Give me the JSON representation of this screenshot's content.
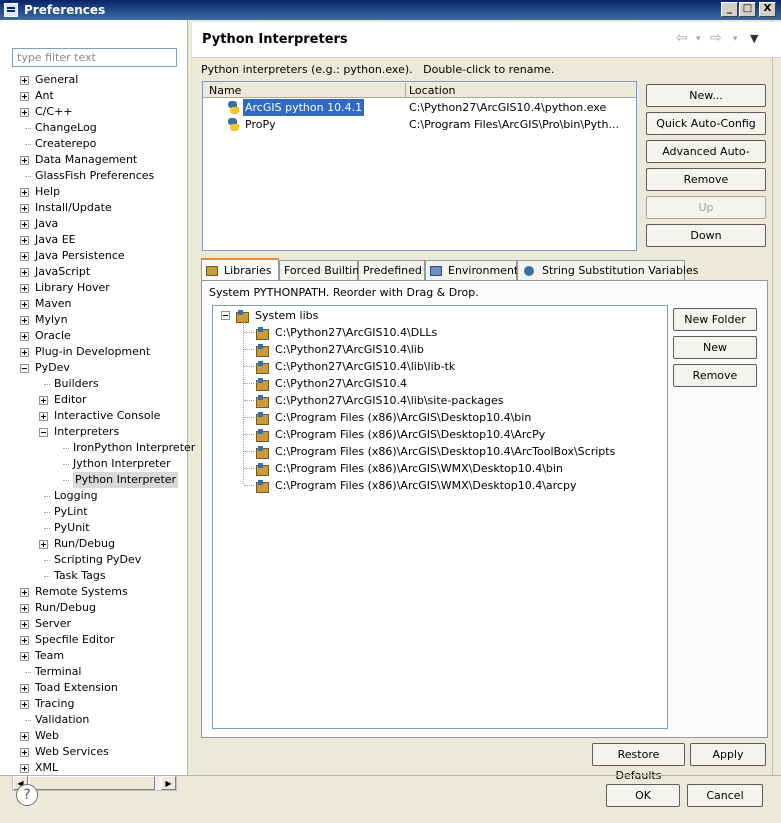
{
  "window": {
    "title": "Preferences",
    "min_label": "_",
    "max_label": "□",
    "close_label": "X"
  },
  "filter": {
    "placeholder": "type filter text"
  },
  "tree": [
    {
      "label": "General",
      "exp": "plus"
    },
    {
      "label": "Ant",
      "exp": "plus"
    },
    {
      "label": "C/C++",
      "exp": "plus"
    },
    {
      "label": "ChangeLog",
      "exp": ""
    },
    {
      "label": "Createrepo",
      "exp": ""
    },
    {
      "label": "Data Management",
      "exp": "plus"
    },
    {
      "label": "GlassFish Preferences",
      "exp": ""
    },
    {
      "label": "Help",
      "exp": "plus"
    },
    {
      "label": "Install/Update",
      "exp": "plus"
    },
    {
      "label": "Java",
      "exp": "plus"
    },
    {
      "label": "Java EE",
      "exp": "plus"
    },
    {
      "label": "Java Persistence",
      "exp": "plus"
    },
    {
      "label": "JavaScript",
      "exp": "plus"
    },
    {
      "label": "Library Hover",
      "exp": "plus"
    },
    {
      "label": "Maven",
      "exp": "plus"
    },
    {
      "label": "Mylyn",
      "exp": "plus"
    },
    {
      "label": "Oracle",
      "exp": "plus"
    },
    {
      "label": "Plug-in Development",
      "exp": "plus"
    },
    {
      "label": "PyDev",
      "exp": "minus"
    },
    {
      "label": "Builders",
      "exp": "",
      "lvl": 1
    },
    {
      "label": "Editor",
      "exp": "plus",
      "lvl": 1
    },
    {
      "label": "Interactive Console",
      "exp": "plus",
      "lvl": 1
    },
    {
      "label": "Interpreters",
      "exp": "minus",
      "lvl": 1
    },
    {
      "label": "IronPython Interpreter",
      "exp": "",
      "lvl": 2
    },
    {
      "label": "Jython Interpreter",
      "exp": "",
      "lvl": 2
    },
    {
      "label": "Python Interpreter",
      "exp": "",
      "lvl": 2,
      "selected": true
    },
    {
      "label": "Logging",
      "exp": "",
      "lvl": 1
    },
    {
      "label": "PyLint",
      "exp": "",
      "lvl": 1
    },
    {
      "label": "PyUnit",
      "exp": "",
      "lvl": 1
    },
    {
      "label": "Run/Debug",
      "exp": "plus",
      "lvl": 1
    },
    {
      "label": "Scripting PyDev",
      "exp": "",
      "lvl": 1
    },
    {
      "label": "Task Tags",
      "exp": "",
      "lvl": 1
    },
    {
      "label": "Remote Systems",
      "exp": "plus"
    },
    {
      "label": "Run/Debug",
      "exp": "plus"
    },
    {
      "label": "Server",
      "exp": "plus"
    },
    {
      "label": "Specfile Editor",
      "exp": "plus"
    },
    {
      "label": "Team",
      "exp": "plus"
    },
    {
      "label": "Terminal",
      "exp": ""
    },
    {
      "label": "Toad Extension",
      "exp": "plus"
    },
    {
      "label": "Tracing",
      "exp": "plus"
    },
    {
      "label": "Validation",
      "exp": ""
    },
    {
      "label": "Web",
      "exp": "plus"
    },
    {
      "label": "Web Services",
      "exp": "plus"
    },
    {
      "label": "XML",
      "exp": "plus"
    }
  ],
  "page": {
    "title": "Python Interpreters",
    "description": "Python interpreters (e.g.: python.exe).   Double-click to rename."
  },
  "interpreters": {
    "columns": [
      "Name",
      "Location"
    ],
    "rows": [
      {
        "name": "ArcGIS python 10.4.1",
        "location": "C:\\Python27\\ArcGIS10.4\\python.exe",
        "selected": true
      },
      {
        "name": "ProPy",
        "location": "C:\\Program Files\\ArcGIS\\Pro\\bin\\Pyth..."
      }
    ]
  },
  "interp_buttons": [
    {
      "label": "New...",
      "disabled": false
    },
    {
      "label": "Quick Auto-Config",
      "disabled": false
    },
    {
      "label": "Advanced Auto-Config",
      "disabled": false
    },
    {
      "label": "Remove",
      "disabled": false
    },
    {
      "label": "Up",
      "disabled": true
    },
    {
      "label": "Down",
      "disabled": false
    }
  ],
  "tabs": [
    "Libraries",
    "Forced Builtins",
    "Predefined",
    "Environment",
    "String Substitution Variables"
  ],
  "libraries": {
    "description": "System PYTHONPATH.   Reorder with Drag & Drop.",
    "root": "System libs",
    "paths": [
      "C:\\Python27\\ArcGIS10.4\\DLLs",
      "C:\\Python27\\ArcGIS10.4\\lib",
      "C:\\Python27\\ArcGIS10.4\\lib\\lib-tk",
      "C:\\Python27\\ArcGIS10.4",
      "C:\\Python27\\ArcGIS10.4\\lib\\site-packages",
      "C:\\Program Files (x86)\\ArcGIS\\Desktop10.4\\bin",
      "C:\\Program Files (x86)\\ArcGIS\\Desktop10.4\\ArcPy",
      "C:\\Program Files (x86)\\ArcGIS\\Desktop10.4\\ArcToolBox\\Scripts",
      "C:\\Program Files (x86)\\ArcGIS\\WMX\\Desktop10.4\\bin",
      "C:\\Program Files (x86)\\ArcGIS\\WMX\\Desktop10.4\\arcpy"
    ],
    "buttons": [
      "New Folder",
      "New Egg/Zip(s)",
      "Remove"
    ]
  },
  "footer": {
    "restore_defaults": "Restore Defaults",
    "apply": "Apply",
    "ok": "OK",
    "cancel": "Cancel",
    "help": "?"
  }
}
